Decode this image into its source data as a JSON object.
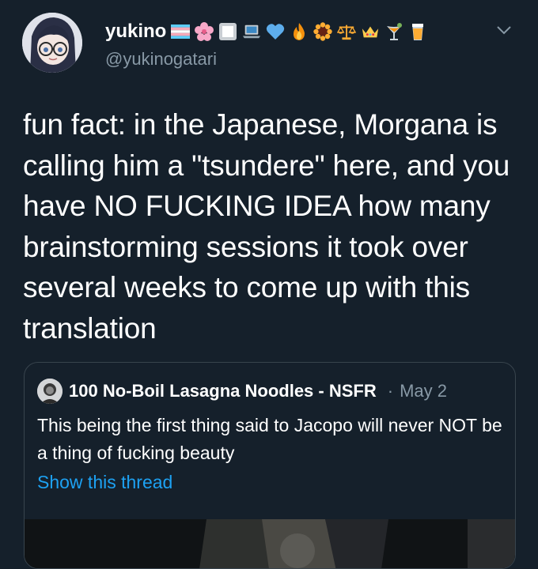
{
  "author": {
    "name": "yukino",
    "handle": "@yukinogatari",
    "emoji_icons": [
      "transgender-flag-icon",
      "cherry-blossom-icon",
      "white-square-icon",
      "laptop-icon",
      "blue-heart-icon",
      "fire-icon",
      "sunflower-icon",
      "balance-scale-icon",
      "crown-icon",
      "cocktail-icon",
      "beer-glass-icon"
    ]
  },
  "tweet": {
    "text": "fun fact: in the Japanese, Morgana is calling him a \"tsundere\" here, and you have NO FUCKING IDEA how many brainstorming sessions it took over several weeks to come up with this translation"
  },
  "quoted_tweet": {
    "author_name": "100 No-Boil Lasagna Noodles - NSFR",
    "separator": "·",
    "date": "May 2",
    "text": "This being the first thing said to Jacopo will never NOT be a thing of fucking beauty",
    "show_thread_label": "Show this thread"
  },
  "colors": {
    "background": "#15202b",
    "secondary_text": "#8899a6",
    "link": "#1da1f2",
    "border": "#38444d"
  }
}
